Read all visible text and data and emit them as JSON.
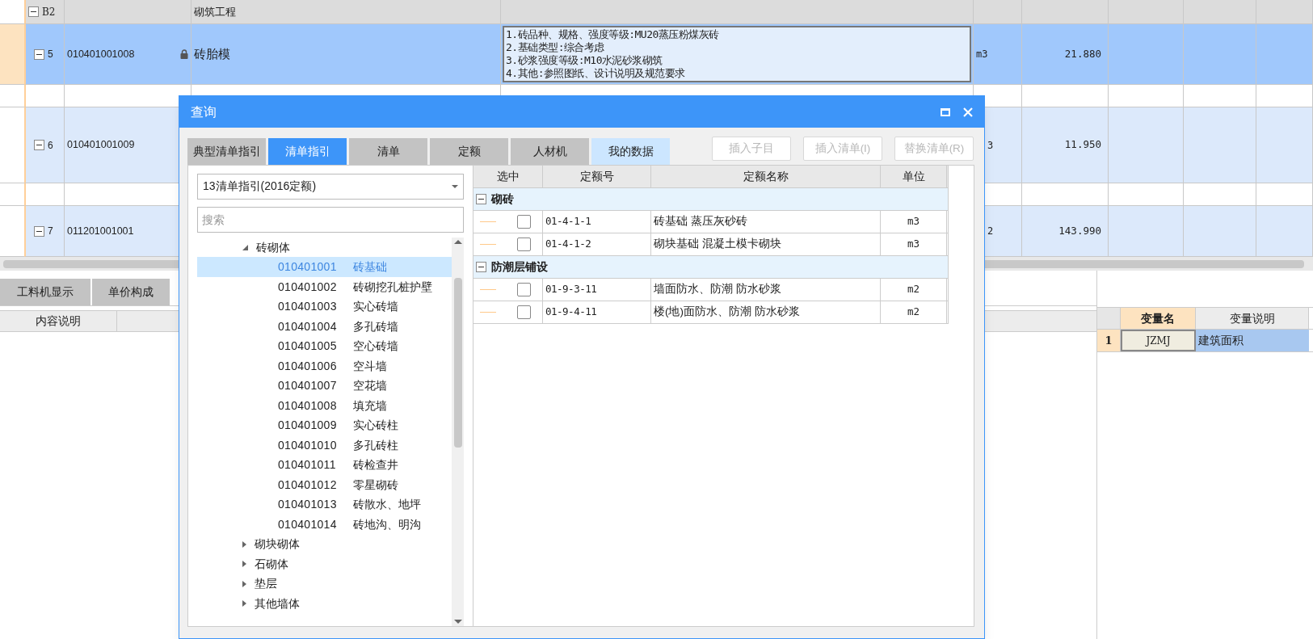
{
  "main_table": {
    "rows": [
      {
        "kind": "group",
        "tree_label": "B2",
        "name": "砌筑工程",
        "expanded": true
      },
      {
        "kind": "item",
        "number": "5",
        "code": "010401001008",
        "locked": true,
        "name": "砖胎模",
        "description": [
          "1.砖品种、规格、强度等级:MU20蒸压粉煤灰砖",
          "2.基础类型:综合考虑",
          "3.砂浆强度等级:M10水泥砂浆砌筑",
          "4.其他:参照图纸、设计说明及规范要求"
        ],
        "unit": "m3",
        "quantity": "21.880",
        "selected": true,
        "expanded": true
      },
      {
        "kind": "spacer"
      },
      {
        "kind": "item",
        "number": "6",
        "code": "010401001009",
        "unit": "3",
        "quantity": "11.950",
        "selected": false,
        "expanded": true
      },
      {
        "kind": "spacer"
      },
      {
        "kind": "item",
        "number": "7",
        "code": "011201001001",
        "unit": "2",
        "quantity": "143.990",
        "selected": false,
        "expanded": true
      }
    ]
  },
  "bottom_panel": {
    "tabs": [
      {
        "label": "工料机显示",
        "selected": false
      },
      {
        "label": "单价构成",
        "selected": false
      }
    ],
    "columns": [
      "内容说明"
    ],
    "variables": {
      "columns": [
        "变量名",
        "变量说明"
      ],
      "rows": [
        {
          "index": "1",
          "name": "JZMJ",
          "description": "建筑面积"
        }
      ]
    }
  },
  "dialog": {
    "title": "查询",
    "tabs": [
      {
        "label": "典型清单指引",
        "selected": false,
        "hovered": false
      },
      {
        "label": "清单指引",
        "selected": true,
        "hovered": false
      },
      {
        "label": "清单",
        "selected": false,
        "hovered": false
      },
      {
        "label": "定额",
        "selected": false,
        "hovered": false
      },
      {
        "label": "人材机",
        "selected": false,
        "hovered": false
      },
      {
        "label": "我的数据",
        "selected": false,
        "hovered": true
      }
    ],
    "buttons": [
      {
        "label": "插入子目",
        "disabled": true
      },
      {
        "label": "插入清单(I)",
        "disabled": true
      },
      {
        "label": "替换清单(R)",
        "disabled": true
      }
    ],
    "library_dropdown": {
      "value": "13清单指引(2016定额)"
    },
    "search": {
      "placeholder": "搜索"
    },
    "tree": [
      {
        "label": "砖砌体",
        "expanded": true,
        "children": [
          {
            "code": "010401001",
            "name": "砖基础",
            "selected": true
          },
          {
            "code": "010401002",
            "name": "砖砌挖孔桩护壁",
            "selected": false
          },
          {
            "code": "010401003",
            "name": "实心砖墙",
            "selected": false
          },
          {
            "code": "010401004",
            "name": "多孔砖墙",
            "selected": false
          },
          {
            "code": "010401005",
            "name": "空心砖墙",
            "selected": false
          },
          {
            "code": "010401006",
            "name": "空斗墙",
            "selected": false
          },
          {
            "code": "010401007",
            "name": "空花墙",
            "selected": false
          },
          {
            "code": "010401008",
            "name": "填充墙",
            "selected": false
          },
          {
            "code": "010401009",
            "name": "实心砖柱",
            "selected": false
          },
          {
            "code": "010401010",
            "name": "多孔砖柱",
            "selected": false
          },
          {
            "code": "010401011",
            "name": "砖检查井",
            "selected": false
          },
          {
            "code": "010401012",
            "name": "零星砌砖",
            "selected": false
          },
          {
            "code": "010401013",
            "name": "砖散水、地坪",
            "selected": false
          },
          {
            "code": "010401014",
            "name": "砖地沟、明沟",
            "selected": false
          }
        ]
      },
      {
        "label": "砌块砌体",
        "expanded": false
      },
      {
        "label": "石砌体",
        "expanded": false
      },
      {
        "label": "垫层",
        "expanded": false
      },
      {
        "label": "其他墙体",
        "expanded": false
      }
    ],
    "quota_table": {
      "columns": [
        "选中",
        "定额号",
        "定额名称",
        "单位"
      ],
      "groups": [
        {
          "name": "砌砖",
          "expanded": true,
          "items": [
            {
              "checked": false,
              "code": "01-4-1-1",
              "name": "砖基础 蒸压灰砂砖",
              "unit": "m3"
            },
            {
              "checked": false,
              "code": "01-4-1-2",
              "name": "砌块基础 混凝土模卡砌块",
              "unit": "m3"
            }
          ]
        },
        {
          "name": "防潮层铺设",
          "expanded": true,
          "items": [
            {
              "checked": false,
              "code": "01-9-3-11",
              "name": "墙面防水、防潮 防水砂浆",
              "unit": "m2"
            },
            {
              "checked": false,
              "code": "01-9-4-11",
              "name": "楼(地)面防水、防潮 防水砂浆",
              "unit": "m2"
            }
          ]
        }
      ]
    }
  }
}
